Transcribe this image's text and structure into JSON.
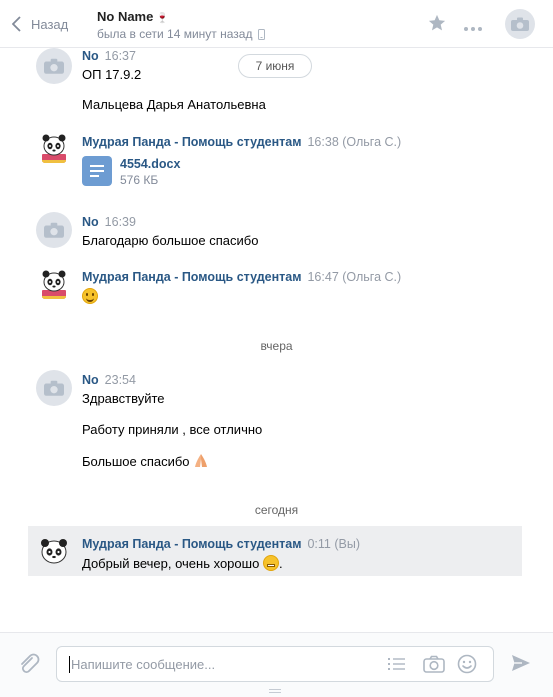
{
  "header": {
    "back_label": "Назад",
    "peer_name": "No Name",
    "peer_status": "была в сети 14 минут назад"
  },
  "history": {
    "date_pill": "7 июня",
    "sep_yesterday": "вчера",
    "sep_today": "сегодня",
    "messages": [
      {
        "author": "No",
        "time": "16:37",
        "lines": [
          "ОП 17.9.2",
          "Мальцева Дарья Анатольевна"
        ]
      },
      {
        "author": "Мудрая Панда - Помощь студентам",
        "time": "16:38 (Ольга С.)",
        "doc_name": "4554.docx",
        "doc_size": "576 КБ"
      },
      {
        "author": "No",
        "time": "16:39",
        "lines": [
          "Благодарю большое спасибо"
        ]
      },
      {
        "author": "Мудрая Панда - Помощь студентам",
        "time": "16:47 (Ольга С.)"
      },
      {
        "author": "No",
        "time": "23:54",
        "lines": [
          "Здравствуйте",
          "Работу приняли , все отлично",
          "Большое спасибо"
        ]
      },
      {
        "author": "Мудрая Панда - Помощь студентам",
        "time": "0:11 (Вы)",
        "lines": [
          "Добрый вечер, очень хорошо"
        ],
        "punct": "."
      }
    ]
  },
  "composer": {
    "placeholder": "Напишите сообщение..."
  },
  "icons": {
    "back": "chevron-left-icon",
    "star": "star-icon",
    "more": "more-icon",
    "attach": "paperclip-icon",
    "template": "list-icon",
    "camera": "camera-icon",
    "emoji": "smile-icon",
    "send": "send-icon"
  },
  "colors": {
    "link": "#2a5885",
    "muted": "#828a99",
    "doc": "#6d9cd2",
    "selected": "#edeef0"
  }
}
